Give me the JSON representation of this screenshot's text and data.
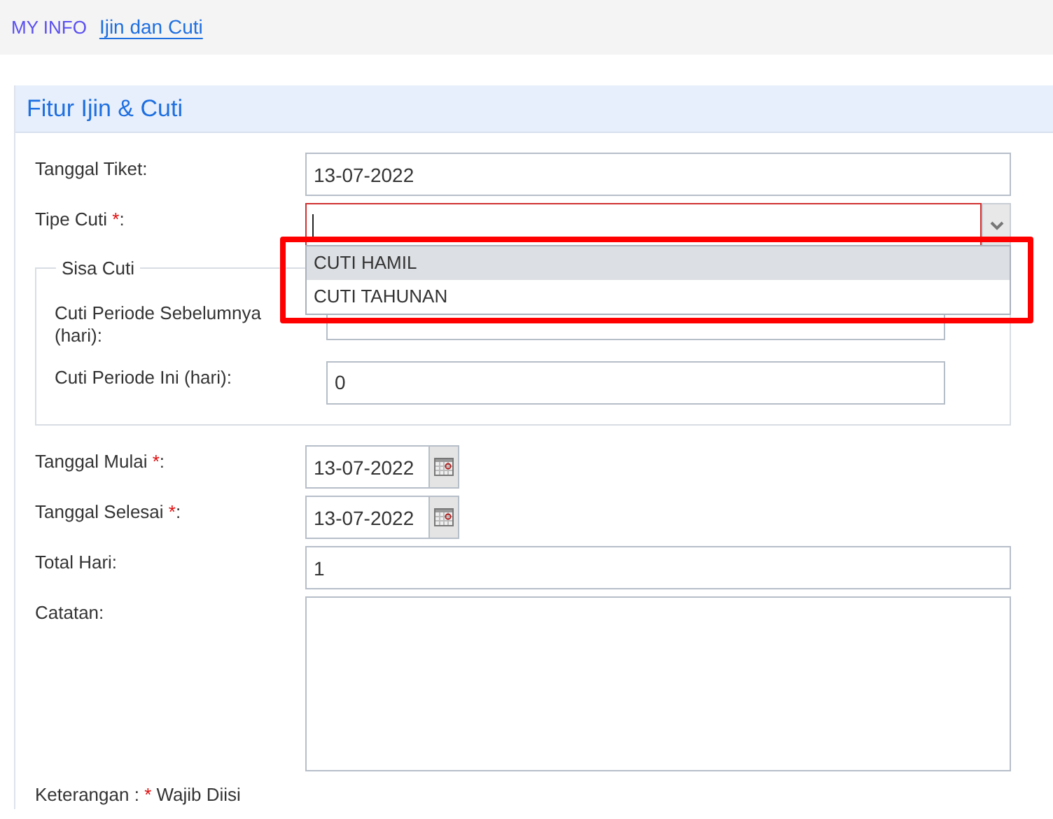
{
  "breadcrumb": [
    {
      "label": "MY INFO",
      "selected": false
    },
    {
      "label": "Ijin dan Cuti",
      "selected": true
    }
  ],
  "panel": {
    "title": "Fitur Ijin & Cuti"
  },
  "fields_top": [
    {
      "kind": "text",
      "label": "Tanggal Tiket",
      "suffix": ":",
      "value": "13-07-2022"
    },
    {
      "kind": "combo",
      "label": "Tipe Cuti ",
      "mark": "*",
      "suffix": ":",
      "invalid": true,
      "expanded": true,
      "options": [
        {
          "label": "CUTI HAMIL",
          "selected": true
        },
        {
          "label": "CUTI TAHUNAN",
          "selected": false
        }
      ]
    }
  ],
  "sisa_cuti": {
    "legend": "Sisa Cuti",
    "fields": [
      {
        "label": "Cuti Periode Sebelumnya (hari):"
      },
      {
        "label": "Cuti Periode Ini (hari):",
        "value": "0"
      }
    ]
  },
  "fields_bottom": [
    {
      "kind": "date",
      "label": "Tanggal Mulai ",
      "mark": "*",
      "suffix": ":",
      "value": "13-07-2022"
    },
    {
      "kind": "date",
      "label": "Tanggal Selesai ",
      "mark": "*",
      "suffix": ":",
      "value": "13-07-2022"
    },
    {
      "kind": "text",
      "label": "Total Hari",
      "suffix": ":",
      "value": "1"
    },
    {
      "kind": "textarea",
      "label": "Catatan",
      "suffix": ":"
    }
  ],
  "note": {
    "text": "Keterangan : ",
    "mark": "*",
    "rest": " Wajib Diisi"
  }
}
